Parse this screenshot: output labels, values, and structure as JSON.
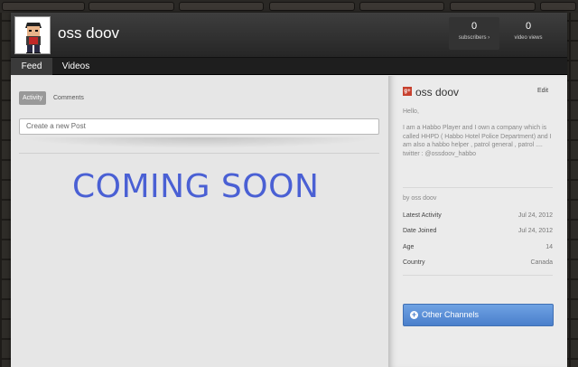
{
  "channel": {
    "name": "oss doov",
    "subscribers": {
      "count": "0",
      "label": "subscribers ›"
    },
    "views": {
      "count": "0",
      "label": "video views"
    }
  },
  "tabs": [
    {
      "label": "Feed",
      "active": true
    },
    {
      "label": "Videos",
      "active": false
    }
  ],
  "feed": {
    "subtabs": [
      {
        "label": "Activity",
        "active": true
      },
      {
        "label": "Comments",
        "active": false
      }
    ],
    "post_placeholder": "Create a new Post",
    "banner_text": "COMING SOON",
    "banner_color": "#4a60d4"
  },
  "sidebar": {
    "icon": "google-plus-icon",
    "name": "oss doov",
    "edit_label": "Edit",
    "greeting": "Hello,",
    "bio": "I am a Habbo Player and I own a company which is called HHPD ( Habbo Hotel Police Department) and I am also a habbo helper , patrol general , patrol .... twitter : @ossdoov_habbo",
    "byline": "by oss doov",
    "details": [
      {
        "label": "Latest Activity",
        "value": "Jul 24, 2012"
      },
      {
        "label": "Date Joined",
        "value": "Jul 24, 2012"
      },
      {
        "label": "Age",
        "value": "14"
      },
      {
        "label": "Country",
        "value": "Canada"
      }
    ],
    "other_channels_label": "Other Channels",
    "accent": "#4a7fcb"
  }
}
